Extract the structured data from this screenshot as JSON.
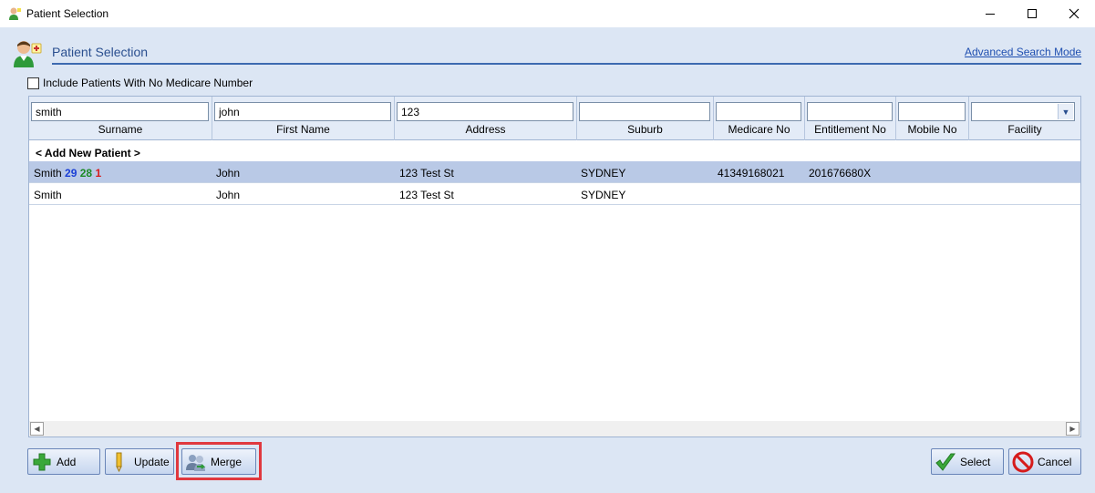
{
  "window": {
    "title": "Patient Selection"
  },
  "header": {
    "title": "Patient Selection",
    "advanced_link": "Advanced Search Mode"
  },
  "options": {
    "include_no_medicare": "Include Patients With No Medicare Number",
    "include_no_medicare_checked": false
  },
  "filters": {
    "surname": "smith",
    "first_name": "john",
    "address": "123",
    "suburb": "",
    "medicare_no": "",
    "entitlement_no": "",
    "mobile_no": "",
    "facility": ""
  },
  "columns": [
    "Surname",
    "First Name",
    "Address",
    "Suburb",
    "Medicare No",
    "Entitlement No",
    "Mobile No",
    "Facility"
  ],
  "add_new_label": "< Add New Patient >",
  "rows": [
    {
      "surname": "Smith",
      "badges": [
        "29",
        "28",
        "1"
      ],
      "first_name": "John",
      "address": "123 Test St",
      "suburb": "SYDNEY",
      "medicare_no": "41349168021",
      "entitlement_no": "201676680X",
      "mobile_no": "",
      "facility": "",
      "selected": true
    },
    {
      "surname": "Smith",
      "first_name": "John",
      "address": "123 Test St",
      "suburb": "SYDNEY",
      "medicare_no": "",
      "entitlement_no": "",
      "mobile_no": "",
      "facility": "",
      "selected": false
    }
  ],
  "buttons": {
    "add": "Add",
    "update": "Update",
    "merge": "Merge",
    "select": "Select",
    "cancel": "Cancel"
  },
  "colors": {
    "accent": "#2a4f8f",
    "selected_row": "#b9c9e6",
    "badge_blue": "#1b3fd6",
    "badge_green": "#1c8a25",
    "badge_red": "#d61b1b",
    "highlight": "#e0383e"
  }
}
